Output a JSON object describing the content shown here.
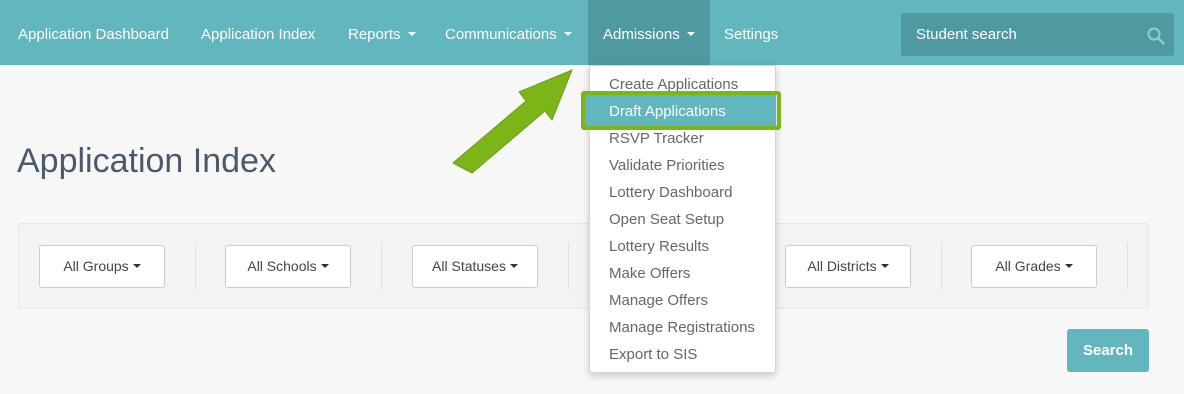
{
  "navbar": {
    "items": [
      {
        "label": "Application Dashboard"
      },
      {
        "label": "Application Index"
      },
      {
        "label": "Reports"
      },
      {
        "label": "Communications"
      },
      {
        "label": "Admissions"
      },
      {
        "label": "Settings"
      }
    ],
    "search": {
      "placeholder": "Student search",
      "icon": "search-icon"
    }
  },
  "page": {
    "title": "Application Index"
  },
  "filters": [
    {
      "label": "All Groups"
    },
    {
      "label": "All Schools"
    },
    {
      "label": "All Statuses"
    },
    {
      "label": "All Districts"
    },
    {
      "label": "All Grades"
    }
  ],
  "search_button": {
    "label": "Search"
  },
  "admissions_menu": {
    "items": [
      {
        "label": "Create Applications"
      },
      {
        "label": "Draft Applications"
      },
      {
        "label": "RSVP Tracker"
      },
      {
        "label": "Validate Priorities"
      },
      {
        "label": "Lottery Dashboard"
      },
      {
        "label": "Open Seat Setup"
      },
      {
        "label": "Lottery Results"
      },
      {
        "label": "Make Offers"
      },
      {
        "label": "Manage Offers"
      },
      {
        "label": "Manage Registrations"
      },
      {
        "label": "Export to SIS"
      }
    ]
  },
  "colors": {
    "navbar": "#62b6bd",
    "navbar_active": "#4f9aa1",
    "highlight_border": "#7cb518",
    "arrow": "#7cb518"
  }
}
